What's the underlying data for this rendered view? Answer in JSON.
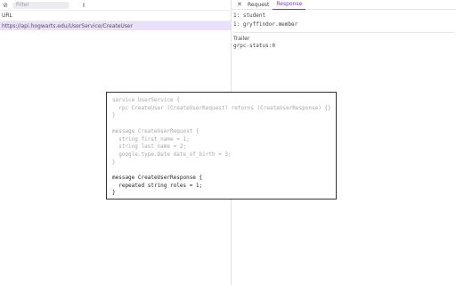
{
  "left": {
    "toolbar": {
      "clear_icon": "circle-slash-icon",
      "filter_placeholder": "Filter",
      "upload_icon": "upload-icon"
    },
    "list_header": "URL",
    "rows": [
      "https://api.hogwarts.edu/UserService/CreateUser"
    ]
  },
  "right": {
    "tabs": [
      {
        "label": "Request",
        "active": false
      },
      {
        "label": "Response",
        "active": true
      }
    ],
    "metadata": [
      "1: student",
      "1: gryffindor.member"
    ],
    "trailer_title": "Trailer",
    "trailers": [
      "grpc-status:0"
    ]
  },
  "proto_popup": {
    "service_lines": [
      "service UserService {",
      "  rpc CreateUser (CreateUserRequest) returns (CreateUserResponse) {}",
      "}"
    ],
    "request_lines": [
      "message CreateUserRequest {",
      "  string first_name = 1;",
      "  string last_name = 2;",
      "  google.type.Date date_of_birth = 3;",
      "}"
    ],
    "response_lines": [
      "message CreateUserResponse {",
      "  repeated string roles = 1;",
      "}"
    ]
  },
  "colors": {
    "accent": "#7a3ac8",
    "selected_row": "#ecdff9",
    "muted_code": "#a7a7a7"
  }
}
